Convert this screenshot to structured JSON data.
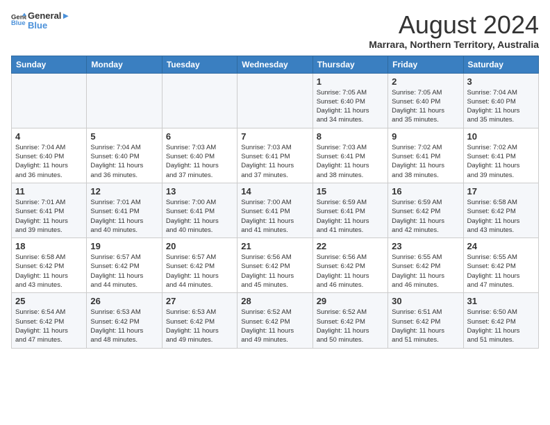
{
  "logo": {
    "line1": "General",
    "line2": "Blue"
  },
  "title": "August 2024",
  "subtitle": "Marrara, Northern Territory, Australia",
  "days_of_week": [
    "Sunday",
    "Monday",
    "Tuesday",
    "Wednesday",
    "Thursday",
    "Friday",
    "Saturday"
  ],
  "weeks": [
    [
      {
        "num": "",
        "info": ""
      },
      {
        "num": "",
        "info": ""
      },
      {
        "num": "",
        "info": ""
      },
      {
        "num": "",
        "info": ""
      },
      {
        "num": "1",
        "info": "Sunrise: 7:05 AM\nSunset: 6:40 PM\nDaylight: 11 hours\nand 34 minutes."
      },
      {
        "num": "2",
        "info": "Sunrise: 7:05 AM\nSunset: 6:40 PM\nDaylight: 11 hours\nand 35 minutes."
      },
      {
        "num": "3",
        "info": "Sunrise: 7:04 AM\nSunset: 6:40 PM\nDaylight: 11 hours\nand 35 minutes."
      }
    ],
    [
      {
        "num": "4",
        "info": "Sunrise: 7:04 AM\nSunset: 6:40 PM\nDaylight: 11 hours\nand 36 minutes."
      },
      {
        "num": "5",
        "info": "Sunrise: 7:04 AM\nSunset: 6:40 PM\nDaylight: 11 hours\nand 36 minutes."
      },
      {
        "num": "6",
        "info": "Sunrise: 7:03 AM\nSunset: 6:40 PM\nDaylight: 11 hours\nand 37 minutes."
      },
      {
        "num": "7",
        "info": "Sunrise: 7:03 AM\nSunset: 6:41 PM\nDaylight: 11 hours\nand 37 minutes."
      },
      {
        "num": "8",
        "info": "Sunrise: 7:03 AM\nSunset: 6:41 PM\nDaylight: 11 hours\nand 38 minutes."
      },
      {
        "num": "9",
        "info": "Sunrise: 7:02 AM\nSunset: 6:41 PM\nDaylight: 11 hours\nand 38 minutes."
      },
      {
        "num": "10",
        "info": "Sunrise: 7:02 AM\nSunset: 6:41 PM\nDaylight: 11 hours\nand 39 minutes."
      }
    ],
    [
      {
        "num": "11",
        "info": "Sunrise: 7:01 AM\nSunset: 6:41 PM\nDaylight: 11 hours\nand 39 minutes."
      },
      {
        "num": "12",
        "info": "Sunrise: 7:01 AM\nSunset: 6:41 PM\nDaylight: 11 hours\nand 40 minutes."
      },
      {
        "num": "13",
        "info": "Sunrise: 7:00 AM\nSunset: 6:41 PM\nDaylight: 11 hours\nand 40 minutes."
      },
      {
        "num": "14",
        "info": "Sunrise: 7:00 AM\nSunset: 6:41 PM\nDaylight: 11 hours\nand 41 minutes."
      },
      {
        "num": "15",
        "info": "Sunrise: 6:59 AM\nSunset: 6:41 PM\nDaylight: 11 hours\nand 41 minutes."
      },
      {
        "num": "16",
        "info": "Sunrise: 6:59 AM\nSunset: 6:42 PM\nDaylight: 11 hours\nand 42 minutes."
      },
      {
        "num": "17",
        "info": "Sunrise: 6:58 AM\nSunset: 6:42 PM\nDaylight: 11 hours\nand 43 minutes."
      }
    ],
    [
      {
        "num": "18",
        "info": "Sunrise: 6:58 AM\nSunset: 6:42 PM\nDaylight: 11 hours\nand 43 minutes."
      },
      {
        "num": "19",
        "info": "Sunrise: 6:57 AM\nSunset: 6:42 PM\nDaylight: 11 hours\nand 44 minutes."
      },
      {
        "num": "20",
        "info": "Sunrise: 6:57 AM\nSunset: 6:42 PM\nDaylight: 11 hours\nand 44 minutes."
      },
      {
        "num": "21",
        "info": "Sunrise: 6:56 AM\nSunset: 6:42 PM\nDaylight: 11 hours\nand 45 minutes."
      },
      {
        "num": "22",
        "info": "Sunrise: 6:56 AM\nSunset: 6:42 PM\nDaylight: 11 hours\nand 46 minutes."
      },
      {
        "num": "23",
        "info": "Sunrise: 6:55 AM\nSunset: 6:42 PM\nDaylight: 11 hours\nand 46 minutes."
      },
      {
        "num": "24",
        "info": "Sunrise: 6:55 AM\nSunset: 6:42 PM\nDaylight: 11 hours\nand 47 minutes."
      }
    ],
    [
      {
        "num": "25",
        "info": "Sunrise: 6:54 AM\nSunset: 6:42 PM\nDaylight: 11 hours\nand 47 minutes."
      },
      {
        "num": "26",
        "info": "Sunrise: 6:53 AM\nSunset: 6:42 PM\nDaylight: 11 hours\nand 48 minutes."
      },
      {
        "num": "27",
        "info": "Sunrise: 6:53 AM\nSunset: 6:42 PM\nDaylight: 11 hours\nand 49 minutes."
      },
      {
        "num": "28",
        "info": "Sunrise: 6:52 AM\nSunset: 6:42 PM\nDaylight: 11 hours\nand 49 minutes."
      },
      {
        "num": "29",
        "info": "Sunrise: 6:52 AM\nSunset: 6:42 PM\nDaylight: 11 hours\nand 50 minutes."
      },
      {
        "num": "30",
        "info": "Sunrise: 6:51 AM\nSunset: 6:42 PM\nDaylight: 11 hours\nand 51 minutes."
      },
      {
        "num": "31",
        "info": "Sunrise: 6:50 AM\nSunset: 6:42 PM\nDaylight: 11 hours\nand 51 minutes."
      }
    ]
  ]
}
